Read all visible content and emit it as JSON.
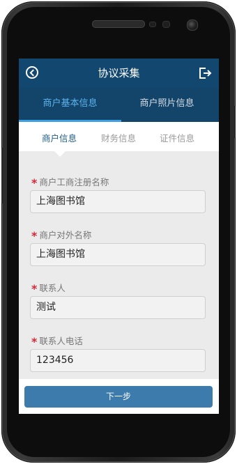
{
  "header": {
    "title": "协议采集"
  },
  "top_tabs": [
    {
      "label": "商户基本信息"
    },
    {
      "label": "商户照片信息"
    }
  ],
  "sub_tabs": [
    {
      "label": "商户信息"
    },
    {
      "label": "财务信息"
    },
    {
      "label": "证件信息"
    }
  ],
  "form": {
    "fields": [
      {
        "required_mark": "*",
        "label": "商户工商注册名称",
        "value": "上海图书馆"
      },
      {
        "required_mark": "*",
        "label": "商户对外名称",
        "value": "上海图书馆"
      },
      {
        "required_mark": "*",
        "label": "联系人",
        "value": "测试"
      },
      {
        "required_mark": "*",
        "label": "联系人电话",
        "value": "123456"
      }
    ]
  },
  "footer": {
    "next_label": "下一步"
  },
  "colors": {
    "header_bg": "#12476f",
    "active_tab": "#5db4ef",
    "required_mark": "#d12a3a",
    "button": "#3c7bab"
  }
}
